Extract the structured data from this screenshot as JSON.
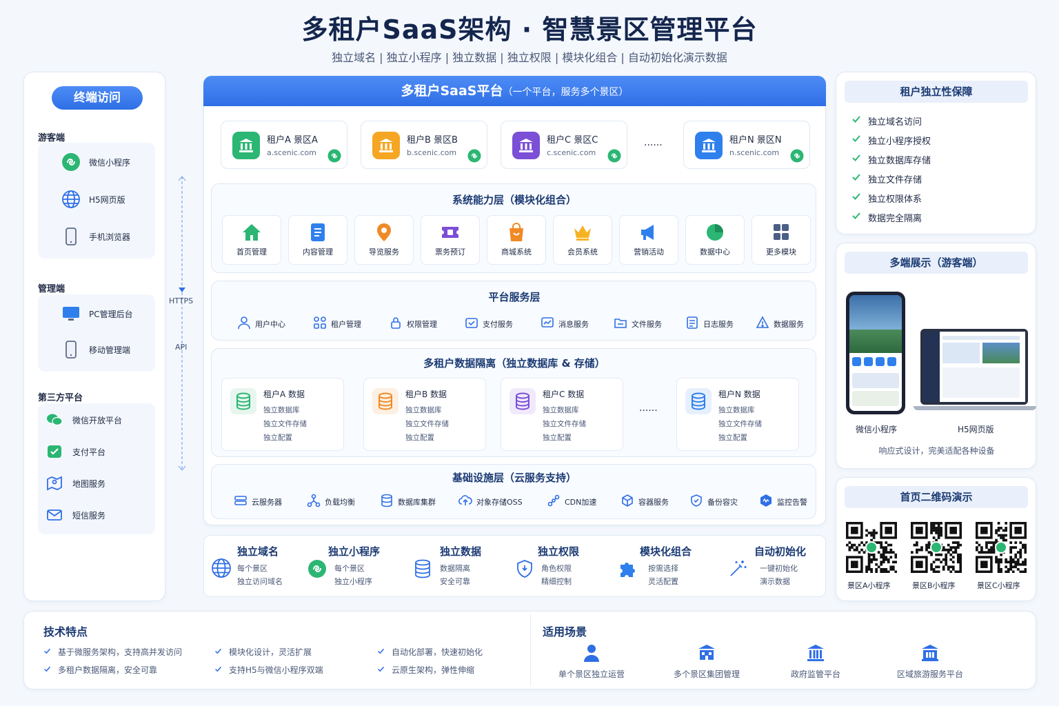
{
  "header": {
    "title": "多租户SaaS架构 · 智慧景区管理平台",
    "subtitle": "独立域名 | 独立小程序 | 独立数据 | 独立权限 | 模块化组合 | 自动初始化演示数据"
  },
  "left": {
    "pill": "终端访问",
    "visitor": {
      "label": "游客端",
      "items": [
        "微信小程序",
        "H5网页版",
        "手机浏览器"
      ]
    },
    "admin": {
      "label": "管理端",
      "items": [
        "PC管理后台",
        "移动管理端"
      ]
    },
    "third": {
      "label": "第三方平台",
      "items": [
        "微信开放平台",
        "支付平台",
        "地图服务",
        "短信服务"
      ]
    },
    "conn": {
      "https": "HTTPS",
      "api": "API"
    }
  },
  "platform": {
    "title": "多租户SaaS平台",
    "title_note": "（一个平台，服务多个景区）",
    "tenants": [
      {
        "name": "租户A 景区A",
        "domain": "a.scenic.com",
        "color": "#2bb673"
      },
      {
        "name": "租户B 景区B",
        "domain": "b.scenic.com",
        "color": "#f5a623"
      },
      {
        "name": "租户C 景区C",
        "domain": "c.scenic.com",
        "color": "#7b4fd6"
      },
      {
        "name": "租户N 景区N",
        "domain": "n.scenic.com",
        "color": "#2f80ed"
      }
    ],
    "ellipsis": "......",
    "capability": {
      "title": "系统能力层（模块化组合）",
      "modules": [
        "首页管理",
        "内容管理",
        "导览服务",
        "票务预订",
        "商城系统",
        "会员系统",
        "营销活动",
        "数据中心",
        "更多模块"
      ]
    },
    "service": {
      "title": "平台服务层",
      "items": [
        "用户中心",
        "租户管理",
        "权限管理",
        "支付服务",
        "消息服务",
        "文件服务",
        "日志服务",
        "数据服务"
      ]
    },
    "isolation": {
      "title": "多租户数据隔离（独立数据库 & 存储）",
      "tenants": [
        {
          "name": "租户A 数据",
          "color": "#2bb673"
        },
        {
          "name": "租户B 数据",
          "color": "#f08a24"
        },
        {
          "name": "租户C 数据",
          "color": "#7b4fd6"
        },
        {
          "name": "租户N 数据",
          "color": "#2f80ed"
        }
      ],
      "lines": [
        "独立数据库",
        "独立文件存储",
        "独立配置"
      ]
    },
    "infra": {
      "title": "基础设施层（云服务支持）",
      "items": [
        "云服务器",
        "负载均衡",
        "数据库集群",
        "对象存储OSS",
        "CDN加速",
        "容器服务",
        "备份容灾",
        "监控告警"
      ]
    }
  },
  "features": [
    {
      "title": "独立域名",
      "lines": [
        "每个景区",
        "独立访问域名"
      ]
    },
    {
      "title": "独立小程序",
      "lines": [
        "每个景区",
        "独立小程序"
      ]
    },
    {
      "title": "独立数据",
      "lines": [
        "数据隔离",
        "安全可靠"
      ]
    },
    {
      "title": "独立权限",
      "lines": [
        "角色权限",
        "精细控制"
      ]
    },
    {
      "title": "模块化组合",
      "lines": [
        "按需选择",
        "灵活配置"
      ]
    },
    {
      "title": "自动初始化",
      "lines": [
        "一键初始化",
        "演示数据"
      ]
    }
  ],
  "right": {
    "guarantee": {
      "title": "租户独立性保障",
      "items": [
        "独立域名访问",
        "独立小程序授权",
        "独立数据库存储",
        "独立文件存储",
        "独立权限体系",
        "数据完全隔离"
      ]
    },
    "multi": {
      "title": "多端展示（游客端）",
      "phone_label": "微信小程序",
      "laptop_label": "H5网页版",
      "caption": "响应式设计，完美适配各种设备"
    },
    "qr": {
      "title": "首页二维码演示",
      "labels": [
        "景区A小程序",
        "景区B小程序",
        "景区C小程序"
      ]
    }
  },
  "bottom": {
    "tech": {
      "title": "技术特点",
      "items": [
        "基于微服务架构，支持高并发访问",
        "模块化设计，灵活扩展",
        "自动化部署，快速初始化",
        "多租户数据隔离，安全可靠",
        "支持H5与微信小程序双端",
        "云原生架构，弹性伸缩"
      ]
    },
    "scenes": {
      "title": "适用场景",
      "items": [
        "单个景区独立运营",
        "多个景区集团管理",
        "政府监管平台",
        "区域旅游服务平台"
      ]
    }
  }
}
